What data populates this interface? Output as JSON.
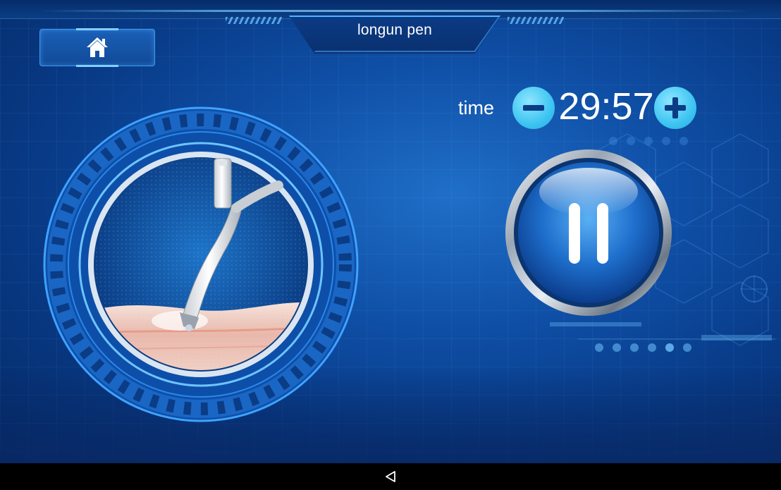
{
  "header": {
    "title": "longun pen",
    "home_icon": "home-icon"
  },
  "timer": {
    "label": "time",
    "value": "29:57",
    "decrement_icon": "minus-icon",
    "increment_icon": "plus-icon"
  },
  "controls": {
    "pause_icon": "pause-icon"
  },
  "illustration": {
    "icon": "pen-handpiece-illustration"
  },
  "navigation": {
    "back_icon": "back-triangle-icon"
  },
  "colors": {
    "background": "#0f4fa6",
    "accent": "#3ec5f2",
    "text": "#ffffff"
  }
}
